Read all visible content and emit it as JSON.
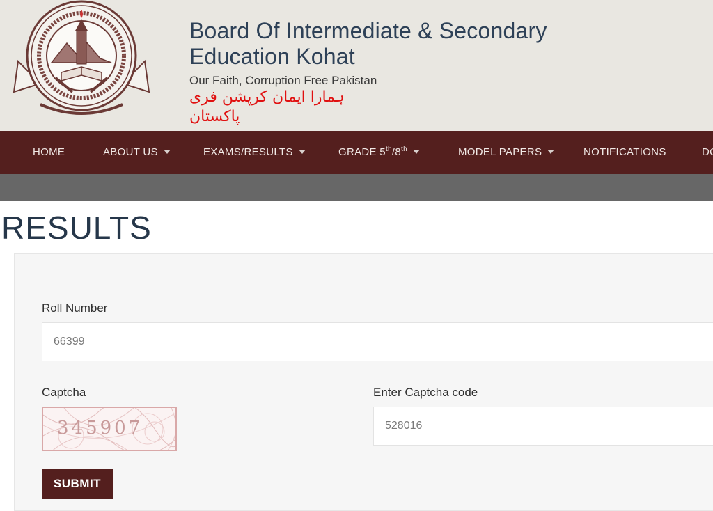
{
  "header": {
    "title_line1": "Board Of Intermediate & Secondary",
    "title_line2": "Education Kohat",
    "tagline": "Our Faith, Corruption Free Pakistan",
    "tagline_urdu": "ہمارا ایمان کرپشن فری پاکستان",
    "logo_icon": "board-seal-logo"
  },
  "nav": {
    "items": [
      {
        "label": "HOME",
        "has_dropdown": false
      },
      {
        "label": "ABOUT US",
        "has_dropdown": true
      },
      {
        "label": "EXAMS/RESULTS",
        "has_dropdown": true
      },
      {
        "label_prefix": "GRADE 5",
        "sup1": "th",
        "mid": "/8",
        "sup2": "th",
        "has_dropdown": true
      },
      {
        "label": "MODEL PAPERS",
        "has_dropdown": true
      },
      {
        "label": "NOTIFICATIONS",
        "has_dropdown": false
      },
      {
        "label": "DO",
        "has_dropdown": false
      }
    ]
  },
  "page": {
    "title": "RESULTS"
  },
  "form": {
    "roll_label": "Roll Number",
    "roll_value": "66399",
    "captcha_label": "Captcha",
    "captcha_text": "345907",
    "captcha_entry_label": "Enter Captcha code",
    "captcha_entry_value": "528016",
    "submit_label": "SUBMIT"
  },
  "colors": {
    "brand": "#541f1e",
    "header_bg": "#e9e7e1",
    "title": "#2e4157",
    "urdu": "#e01010",
    "subbar": "#676767"
  }
}
